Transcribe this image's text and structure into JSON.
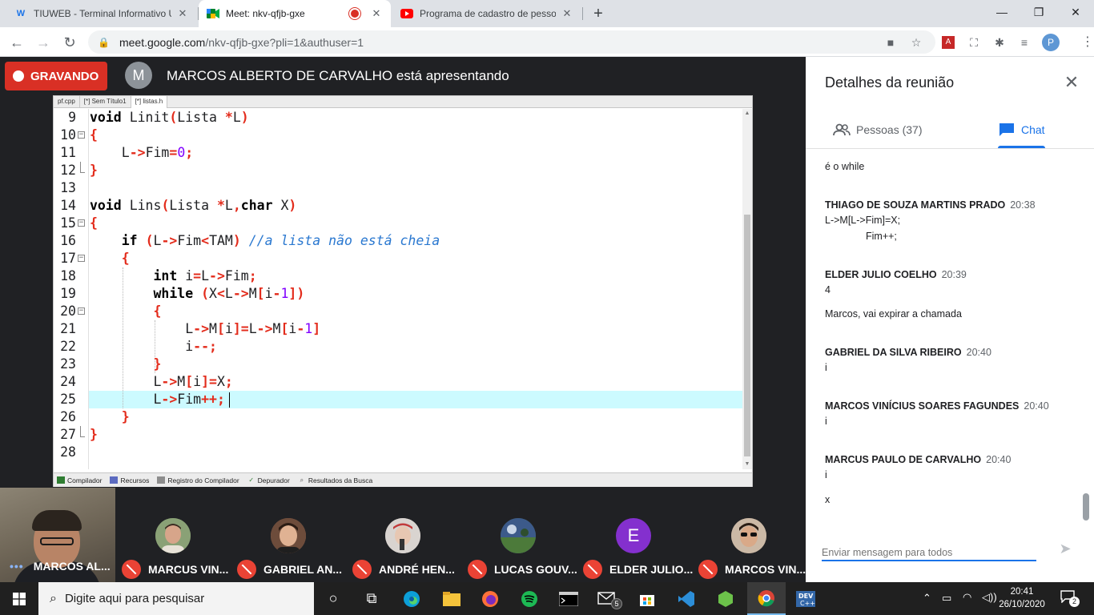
{
  "browser": {
    "tabs": [
      {
        "title": "TIUWEB - Terminal Informativo U",
        "favicon": "tiuweb-icon"
      },
      {
        "title": "Meet: nkv-qfjb-gxe",
        "favicon": "meet-icon",
        "active": true
      },
      {
        "title": "Programa de cadastro de pessoa",
        "favicon": "youtube-icon"
      }
    ],
    "url_host": "meet.google.com",
    "url_path": "/nkv-qfjb-gxe?pli=1&authuser=1",
    "profile_initial": "P"
  },
  "meet": {
    "recording_label": "GRAVANDO",
    "presenter_initial": "M",
    "presenter_text": "MARCOS ALBERTO DE CARVALHO está apresentando"
  },
  "ide": {
    "file_tabs": [
      "pf.cpp",
      "[*] Sem Título1",
      "[*] listas.h"
    ],
    "active_tab": 2,
    "bottom_tabs": [
      "Compilador",
      "Recursos",
      "Registro do Compilador",
      "Depurador",
      "Resultados da Busca"
    ],
    "line_numbers": [
      "9",
      "10",
      "11",
      "12",
      "13",
      "14",
      "15",
      "16",
      "17",
      "18",
      "19",
      "20",
      "21",
      "22",
      "23",
      "24",
      "25",
      "26",
      "27",
      "28"
    ],
    "current_line_index": 16,
    "tokens": {
      "void": "void",
      "linit": "Linit",
      "lins": "Lins",
      "lista": "Lista",
      "L": "L",
      "arrow": "->",
      "fim": "Fim",
      "eq": "=",
      "zero": "0",
      "semi": ";",
      "lparen": "(",
      "rparen": ")",
      "star": "*",
      "lbrace": "{",
      "rbrace": "}",
      "comma": ",",
      "char": "char",
      "X": "X",
      "if": "if",
      "lt": "<",
      "tam": "TAM",
      "comment": "//a lista não está cheia",
      "int": "int",
      "i": "i",
      "while": "while",
      "M": "M",
      "lbrack": "[",
      "rbrack": "]",
      "minus": "-",
      "one": "1",
      "decr": "--",
      "incr": "++"
    }
  },
  "participants": [
    {
      "name": "MARCOS AL...",
      "self": true
    },
    {
      "name": "MARCUS VIN...",
      "avatar": "photo",
      "color": "#7d9a6a"
    },
    {
      "name": "GABRIEL AN...",
      "avatar": "photo",
      "color": "#a26a4f"
    },
    {
      "name": "ANDRÉ HEN...",
      "avatar": "photo",
      "color": "#c9c2bd"
    },
    {
      "name": "LUCAS GOUV...",
      "avatar": "photo",
      "color": "#4a6a4d"
    },
    {
      "name": "ELDER JULIO...",
      "avatar": "initial",
      "initial": "E",
      "color": "#8430ce"
    },
    {
      "name": "MARCOS VIN...",
      "avatar": "photo",
      "color": "#b89b83"
    }
  ],
  "side_panel": {
    "title": "Detalhes da reunião",
    "people_tab": "Pessoas (37)",
    "chat_tab": "Chat",
    "messages": [
      {
        "text": "é o while"
      },
      {
        "sender": "THIAGO DE SOUZA MARTINS PRADO",
        "time": "20:38"
      },
      {
        "text": "L->M[L->Fim]=X;"
      },
      {
        "text": "Fim++;"
      },
      {
        "sender": "ELDER JULIO COELHO",
        "time": "20:39"
      },
      {
        "text": "4"
      },
      {
        "text": "Marcos, vai expirar a chamada"
      },
      {
        "sender": "GABRIEL DA SILVA RIBEIRO",
        "time": "20:40"
      },
      {
        "text": "i"
      },
      {
        "sender": "MARCOS VINÍCIUS SOARES FAGUNDES",
        "time": "20:40"
      },
      {
        "text": "i"
      },
      {
        "sender": "MARCUS PAULO DE CARVALHO",
        "time": "20:40"
      },
      {
        "text": "i"
      },
      {
        "text": "x"
      }
    ],
    "input_placeholder": "Enviar mensagem para todos"
  },
  "taskbar": {
    "search_placeholder": "Digite aqui para pesquisar",
    "mail_badge": "5",
    "clock_time": "20:41",
    "clock_date": "26/10/2020",
    "notification_count": "2"
  }
}
